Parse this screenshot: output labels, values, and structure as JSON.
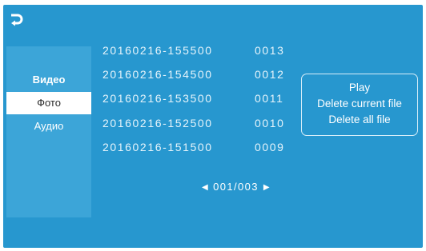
{
  "sidebar": {
    "items": [
      {
        "label": "Видео"
      },
      {
        "label": "Фото"
      },
      {
        "label": "Аудио"
      }
    ]
  },
  "files": [
    {
      "name": "20160216-155500",
      "number": "0013"
    },
    {
      "name": "20160216-154500",
      "number": "0012"
    },
    {
      "name": "20160216-153500",
      "number": "0011"
    },
    {
      "name": "20160216-152500",
      "number": "0010"
    },
    {
      "name": "20160216-151500",
      "number": "0009"
    }
  ],
  "context_menu": {
    "play": "Play",
    "delete_current": "Delete current file",
    "delete_all": "Delete all file"
  },
  "pager": {
    "text": "001/003",
    "current_page": 1,
    "total_pages": 3,
    "prev_icon": "triangle-left-icon",
    "next_icon": "triangle-right-icon"
  },
  "icons": {
    "back": "return-arrow-icon"
  },
  "colors": {
    "background": "#2797cf",
    "sidebar": "#3ca5d8",
    "selected_item_bg": "#ffffff",
    "text": "#ffffff"
  }
}
